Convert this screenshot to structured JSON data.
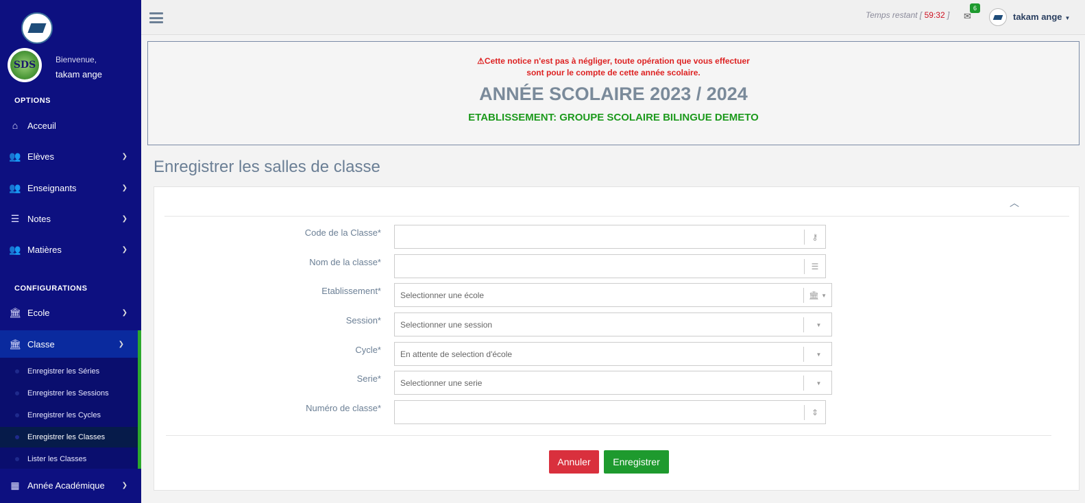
{
  "sidebar": {
    "welcome": "Bienvenue,",
    "user_name": "takam ange",
    "avatar_text": "SDS",
    "options_heading": "OPTIONS",
    "configurations_heading": "CONFIGURATIONS",
    "items": [
      {
        "label": "Acceuil",
        "icon": "home-icon"
      },
      {
        "label": "Elèves",
        "icon": "users-icon"
      },
      {
        "label": "Enseignants",
        "icon": "users-icon"
      },
      {
        "label": "Notes",
        "icon": "list-icon"
      },
      {
        "label": "Matières",
        "icon": "users-icon"
      }
    ],
    "config_items": [
      {
        "label": "Ecole",
        "icon": "institution-icon"
      },
      {
        "label": "Classe",
        "icon": "institution-icon"
      },
      {
        "label": "Année Académique",
        "icon": "table-icon"
      }
    ],
    "classe_sub": [
      {
        "label": "Enregistrer les Séries"
      },
      {
        "label": "Enregistrer les Sessions"
      },
      {
        "label": "Enregistrer les Cycles"
      },
      {
        "label": "Enregistrer les Classes"
      },
      {
        "label": "Lister les Classes"
      }
    ]
  },
  "topbar": {
    "timer_label": "Temps restant [",
    "timer_value": "59:32",
    "timer_close": "]",
    "mail_badge": "6",
    "user_name": "takam ange"
  },
  "notice": {
    "warning_line1": "Cette notice n'est pas à négliger, toute opération que vous effectuer",
    "warning_line2": "sont pour le compte de cette année scolaire.",
    "year": "ANNÉE SCOLAIRE 2023 / 2024",
    "etablissement": "ETABLISSEMENT: GROUPE SCOLAIRE BILINGUE DEMETO"
  },
  "page_title": "Enregistrer les salles de classe",
  "form": {
    "fields": [
      {
        "label": "Code de la Classe*",
        "value": "",
        "addon_icon": "key-icon"
      },
      {
        "label": "Nom de la classe*",
        "value": "",
        "addon_icon": "list-icon"
      },
      {
        "label": "Etablissement*",
        "value": "Selectionner une école",
        "addon_icon": "institution-icon"
      },
      {
        "label": "Session*",
        "value": "Selectionner une session",
        "addon_icon": "caret-down-icon"
      },
      {
        "label": "Cycle*",
        "value": "En attente de selection d'école",
        "addon_icon": "caret-down-icon"
      },
      {
        "label": "Serie*",
        "value": "Selectionner une serie",
        "addon_icon": "caret-down-icon"
      },
      {
        "label": "Numéro de classe*",
        "value": "",
        "addon_icon": "stepper-icon"
      }
    ],
    "cancel_label": "Annuler",
    "save_label": "Enregistrer"
  },
  "colors": {
    "sidebar_bg": "#0d1080",
    "accent_green": "#1e9a2e",
    "danger_red": "#d9303d",
    "title_gray": "#6b7f95"
  }
}
